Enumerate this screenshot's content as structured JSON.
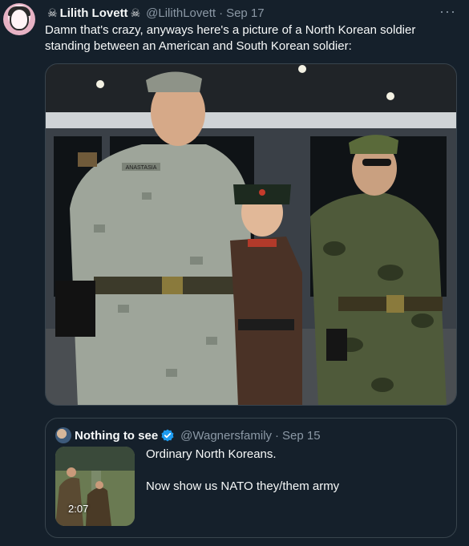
{
  "tweet": {
    "display_name": "Lilith Lovett",
    "name_decoration_icon": "skull-crossbones",
    "handle": "@LilithLovett",
    "separator": "·",
    "date": "Sep 17",
    "more_label": "···",
    "text": "Damn that's crazy, anyways here's a picture of a North Korean soldier standing between an American and South Korean soldier:"
  },
  "media": {
    "uniform_name_tape": "ANASTASIA"
  },
  "quoted_tweet": {
    "display_name": "Nothing to see",
    "verified_icon": "verified-badge-icon",
    "handle": "@Wagnersfamily",
    "separator": "·",
    "date": "Sep 15",
    "text": "Ordinary North Koreans.\n\nNow show us NATO they/them army",
    "video_duration": "2:07"
  },
  "colors": {
    "background": "#15202b",
    "text": "#f7f9f9",
    "secondary_text": "#8b98a5",
    "border": "#38444d",
    "verified": "#1d9bf0"
  }
}
